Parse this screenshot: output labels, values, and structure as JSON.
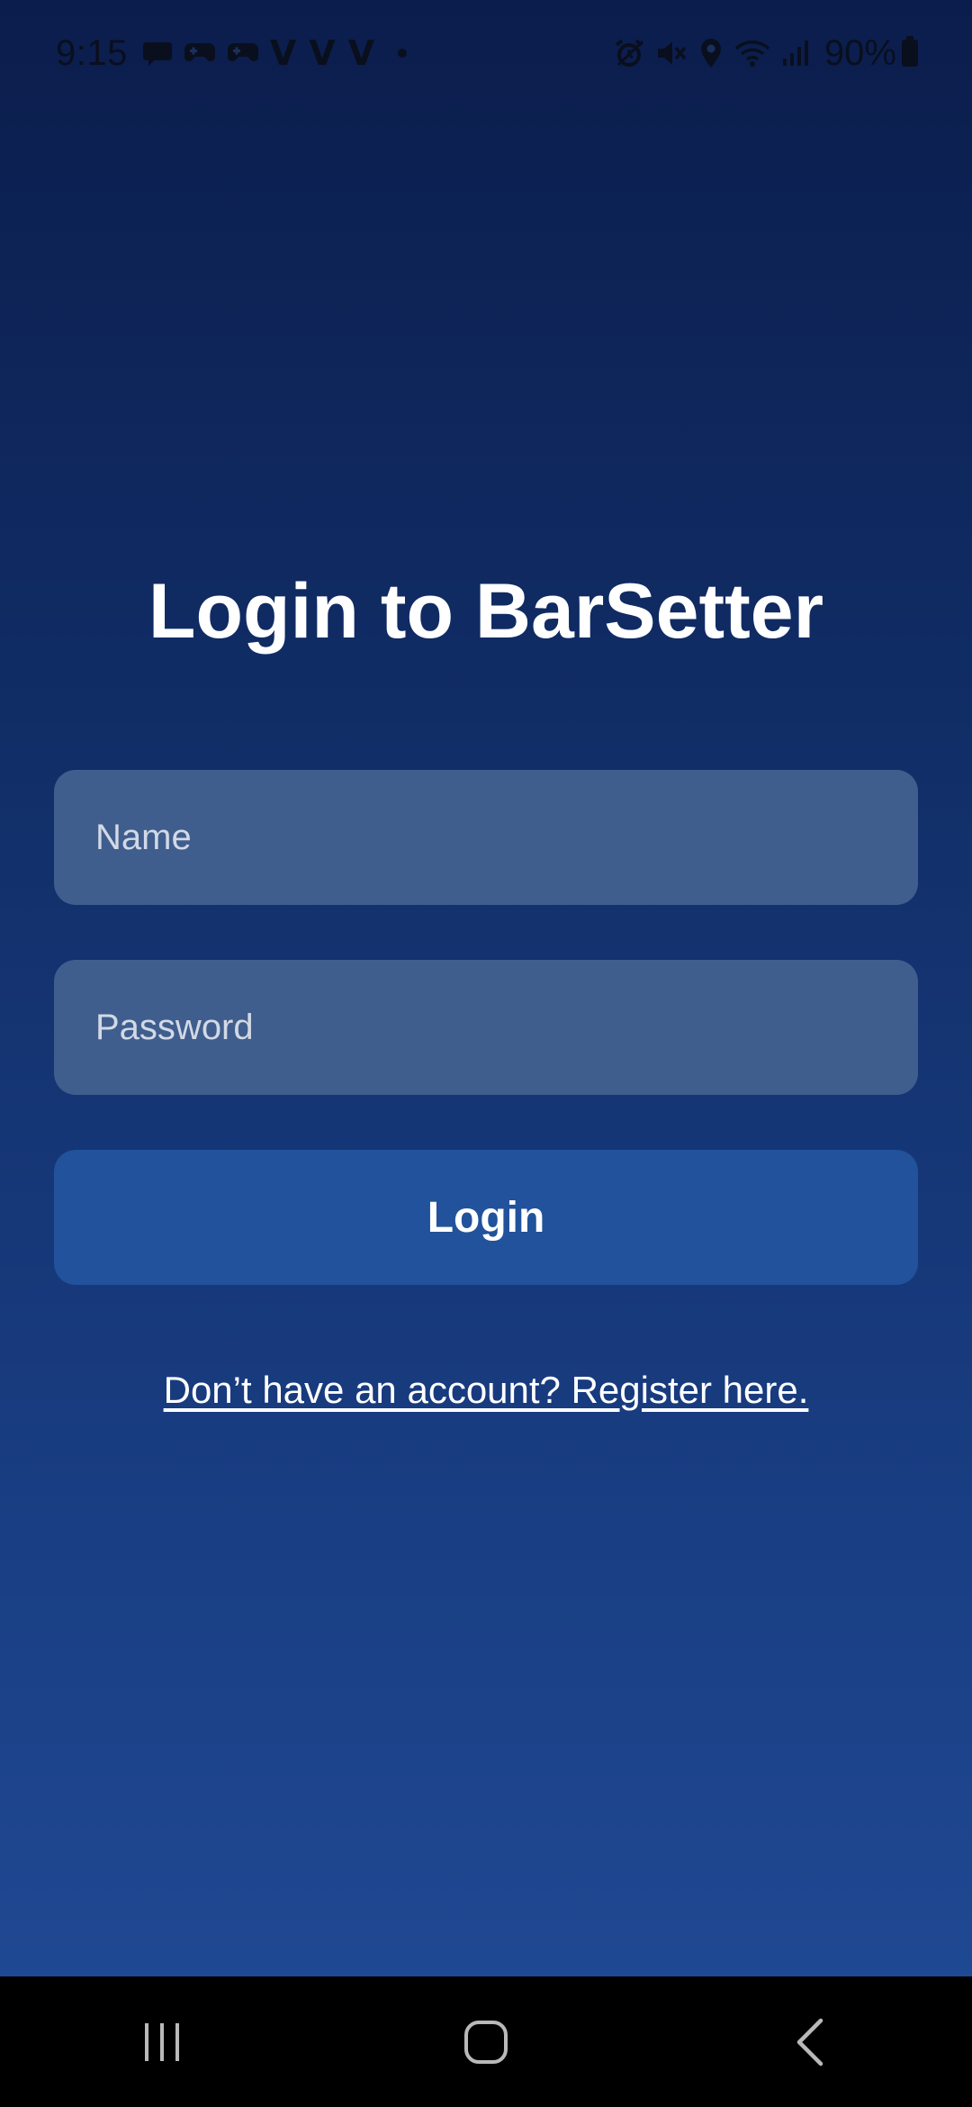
{
  "status_bar": {
    "time": "9:15",
    "battery_percent": "90%",
    "notification_icons": [
      "chat-bubble-icon",
      "game-controller-icon",
      "game-controller-icon",
      "v-app-icon",
      "v-app-icon",
      "v-app-icon",
      "dot-icon"
    ],
    "system_icons": [
      "alarm-icon",
      "mute-icon",
      "location-icon",
      "wifi-icon",
      "signal-icon",
      "battery-icon"
    ],
    "v_label": "V"
  },
  "login": {
    "title": "Login to BarSetter",
    "name_placeholder": "Name",
    "name_value": "",
    "password_placeholder": "Password",
    "password_value": "",
    "login_button_label": "Login",
    "register_link": "Don’t have an account? Register here."
  },
  "nav_bar": {
    "buttons": [
      "recent-apps-icon",
      "home-icon",
      "back-icon"
    ]
  },
  "colors": {
    "background_top": "#0b1d4c",
    "background_bottom": "#214c97",
    "input_fill": "#3f5e8d",
    "button_fill": "#21529b",
    "text": "#ffffff"
  }
}
